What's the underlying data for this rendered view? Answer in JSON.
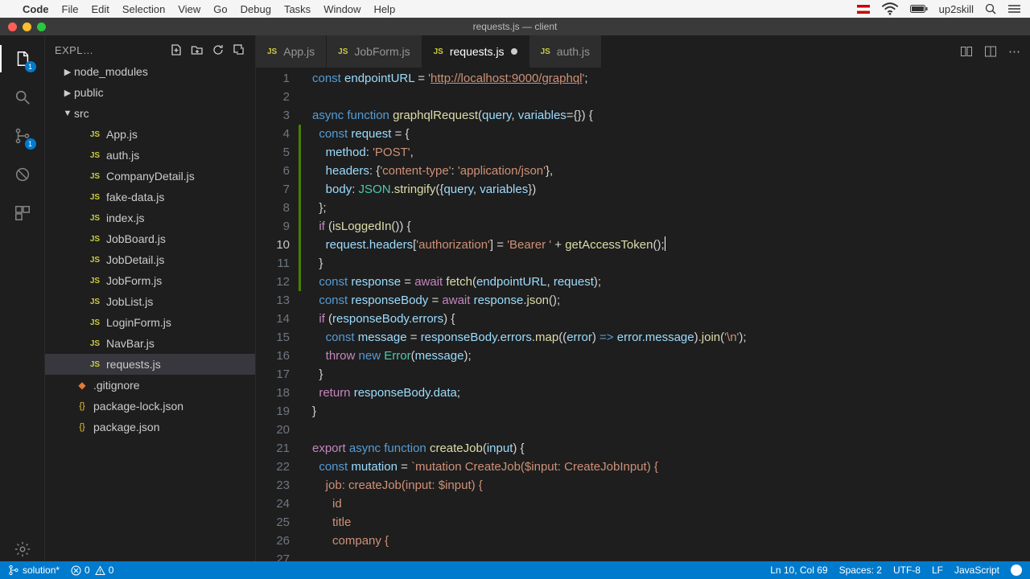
{
  "mac_menu": {
    "app": "Code",
    "items": [
      "File",
      "Edit",
      "Selection",
      "View",
      "Go",
      "Debug",
      "Tasks",
      "Window",
      "Help"
    ],
    "right_user": "up2skill"
  },
  "window_title": "requests.js — client",
  "activity_badges": {
    "explorer": "1",
    "scm": "1"
  },
  "explorer": {
    "title": "EXPL…",
    "tree": [
      {
        "kind": "folder",
        "label": "node_modules",
        "chev": "▶",
        "indent": 1
      },
      {
        "kind": "folder",
        "label": "public",
        "chev": "▶",
        "indent": 1
      },
      {
        "kind": "folder",
        "label": "src",
        "chev": "▼",
        "indent": 1
      },
      {
        "kind": "js",
        "label": "App.js",
        "indent": 2
      },
      {
        "kind": "js",
        "label": "auth.js",
        "indent": 2
      },
      {
        "kind": "js",
        "label": "CompanyDetail.js",
        "indent": 2
      },
      {
        "kind": "js",
        "label": "fake-data.js",
        "indent": 2
      },
      {
        "kind": "js",
        "label": "index.js",
        "indent": 2
      },
      {
        "kind": "js",
        "label": "JobBoard.js",
        "indent": 2
      },
      {
        "kind": "js",
        "label": "JobDetail.js",
        "indent": 2
      },
      {
        "kind": "js",
        "label": "JobForm.js",
        "indent": 2
      },
      {
        "kind": "js",
        "label": "JobList.js",
        "indent": 2
      },
      {
        "kind": "js",
        "label": "LoginForm.js",
        "indent": 2
      },
      {
        "kind": "js",
        "label": "NavBar.js",
        "indent": 2
      },
      {
        "kind": "js",
        "label": "requests.js",
        "indent": 2,
        "selected": true
      },
      {
        "kind": "git",
        "label": ".gitignore",
        "indent": 1
      },
      {
        "kind": "json",
        "label": "package-lock.json",
        "indent": 1
      },
      {
        "kind": "json",
        "label": "package.json",
        "indent": 1
      }
    ]
  },
  "tabs": [
    {
      "label": "App.js"
    },
    {
      "label": "JobForm.js"
    },
    {
      "label": "requests.js",
      "active": true,
      "dirty": true
    },
    {
      "label": "auth.js"
    }
  ],
  "code": {
    "line_start": 1,
    "highlight_lines": [
      4,
      5,
      6,
      7,
      8,
      9,
      10,
      11,
      12
    ],
    "current": 10
  },
  "statusbar": {
    "branch": "solution*",
    "errors": "0",
    "warnings": "0",
    "position": "Ln 10, Col 69",
    "spaces": "Spaces: 2",
    "encoding": "UTF-8",
    "eol": "LF",
    "language": "JavaScript"
  }
}
